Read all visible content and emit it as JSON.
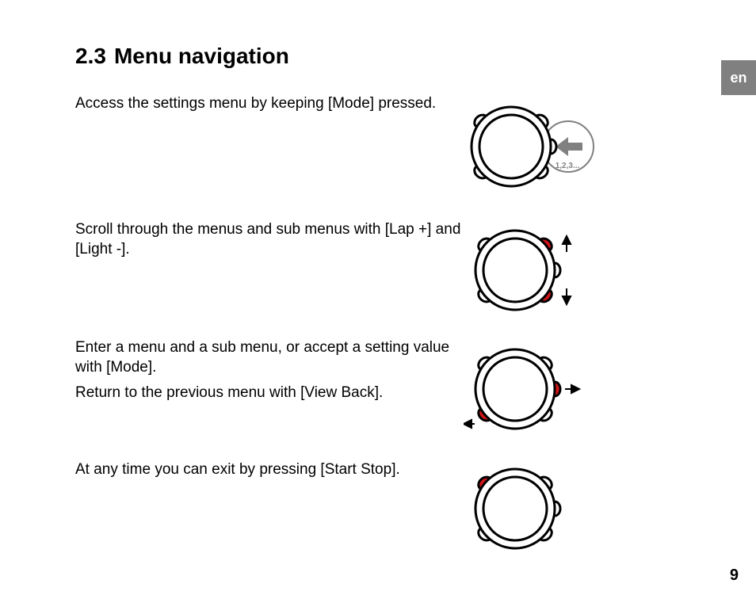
{
  "language_tab": "en",
  "heading": {
    "number": "2.3",
    "title": "Menu navigation"
  },
  "rows": [
    {
      "text1": "Access the settings menu by keeping [Mode] pressed.",
      "text2": ""
    },
    {
      "text1": "Scroll through the menus and sub menus with [Lap +] and [Light -].",
      "text2": ""
    },
    {
      "text1": "Enter a menu and a sub menu, or accept a setting value with [Mode].",
      "text2": "Return to the previous menu with [View Back]."
    },
    {
      "text1": "At any time you can exit by pressing [Start Stop].",
      "text2": ""
    }
  ],
  "hold_label": "1,2,3...",
  "page_number": "9",
  "colors": {
    "accent": "#d1151a",
    "gray": "#808080"
  }
}
